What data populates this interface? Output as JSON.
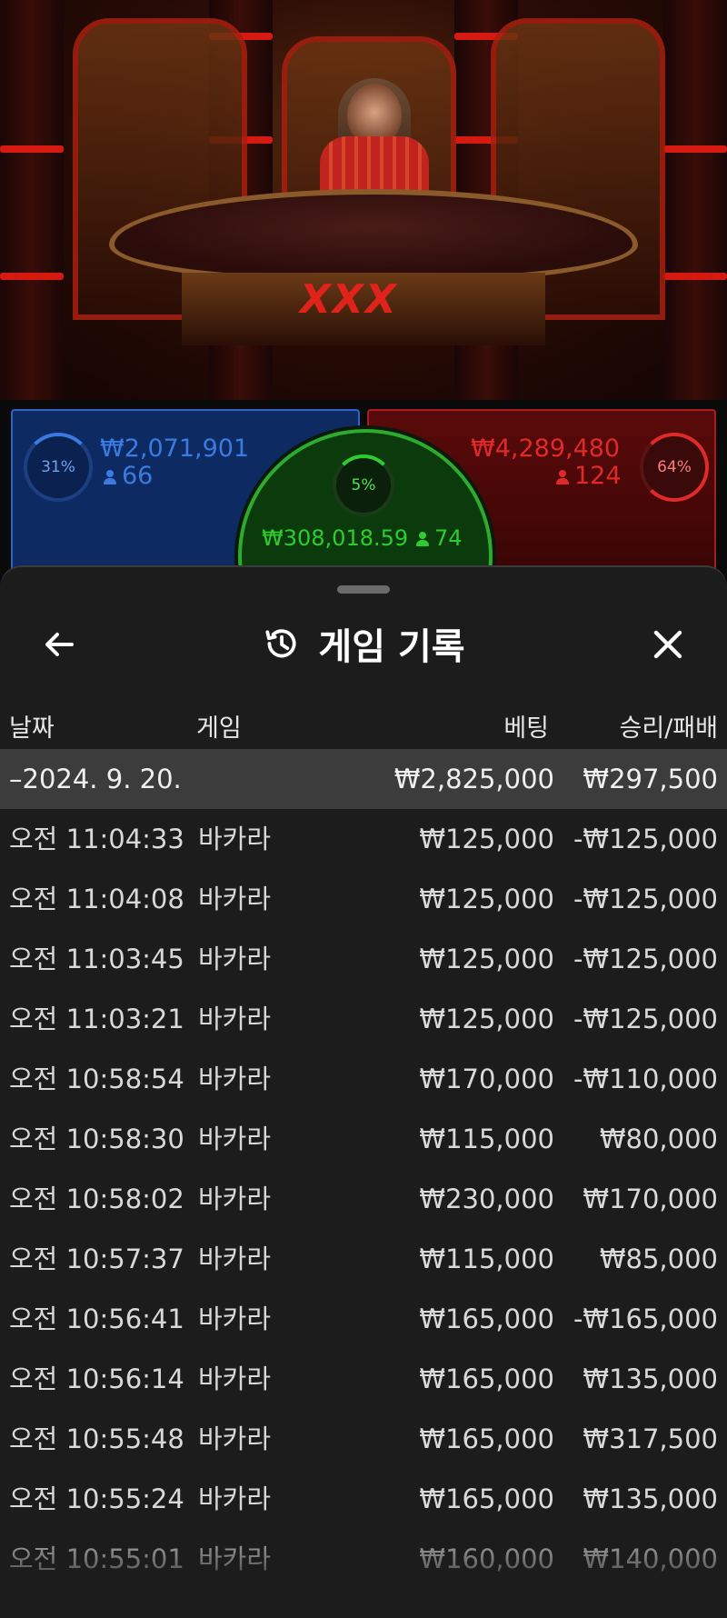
{
  "scene": {
    "logo_text": "XXX"
  },
  "bets": {
    "player": {
      "percent_label": "31%",
      "amount": "₩2,071,901",
      "players": "66",
      "color": "#3b7be0"
    },
    "tie": {
      "percent_label": "5%",
      "amount": "₩308,018.59",
      "players": "74",
      "color": "#2ecc2e"
    },
    "banker": {
      "percent_label": "64%",
      "amount": "₩4,289,480",
      "players": "124",
      "color": "#e02a2a"
    }
  },
  "history": {
    "title": "게임 기록",
    "title_icon": "history-icon",
    "back_icon": "arrow-left-icon",
    "close_icon": "close-icon",
    "columns": {
      "date": "날짜",
      "game": "게임",
      "bet": "베팅",
      "win_loss": "승리/패배"
    },
    "summary": {
      "date": "–2024. 9. 20.",
      "bet": "₩2,825,000",
      "win_loss": "₩297,500"
    },
    "rows": [
      {
        "time": "오전 11:04:33",
        "game": "바카라",
        "bet": "₩125,000",
        "win_loss": "-₩125,000"
      },
      {
        "time": "오전 11:04:08",
        "game": "바카라",
        "bet": "₩125,000",
        "win_loss": "-₩125,000"
      },
      {
        "time": "오전 11:03:45",
        "game": "바카라",
        "bet": "₩125,000",
        "win_loss": "-₩125,000"
      },
      {
        "time": "오전 11:03:21",
        "game": "바카라",
        "bet": "₩125,000",
        "win_loss": "-₩125,000"
      },
      {
        "time": "오전 10:58:54",
        "game": "바카라",
        "bet": "₩170,000",
        "win_loss": "-₩110,000"
      },
      {
        "time": "오전 10:58:30",
        "game": "바카라",
        "bet": "₩115,000",
        "win_loss": "₩80,000"
      },
      {
        "time": "오전 10:58:02",
        "game": "바카라",
        "bet": "₩230,000",
        "win_loss": "₩170,000"
      },
      {
        "time": "오전 10:57:37",
        "game": "바카라",
        "bet": "₩115,000",
        "win_loss": "₩85,000"
      },
      {
        "time": "오전 10:56:41",
        "game": "바카라",
        "bet": "₩165,000",
        "win_loss": "-₩165,000"
      },
      {
        "time": "오전 10:56:14",
        "game": "바카라",
        "bet": "₩165,000",
        "win_loss": "₩135,000"
      },
      {
        "time": "오전 10:55:48",
        "game": "바카라",
        "bet": "₩165,000",
        "win_loss": "₩317,500"
      },
      {
        "time": "오전 10:55:24",
        "game": "바카라",
        "bet": "₩165,000",
        "win_loss": "₩135,000"
      },
      {
        "time": "오전 10:55:01",
        "game": "바카라",
        "bet": "₩160,000",
        "win_loss": "₩140,000"
      }
    ]
  }
}
